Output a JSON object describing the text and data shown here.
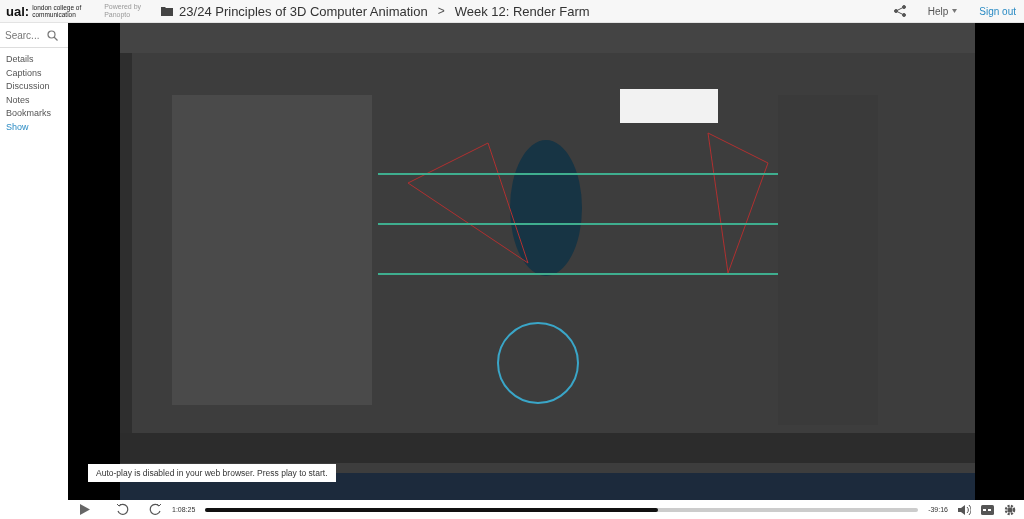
{
  "header": {
    "logo": {
      "mark": "ual:",
      "subtitle": "london college of communication"
    },
    "powered_by": "Powered by\nPanopto",
    "breadcrumb": [
      {
        "label": "23/24 Principles of 3D Computer Animation"
      },
      {
        "label": "Week 12: Render Farm"
      }
    ],
    "separator": ">",
    "help": "Help",
    "sign_out": "Sign out"
  },
  "sidebar": {
    "search": {
      "placeholder": "Searc..."
    },
    "items": [
      {
        "label": "Details",
        "selected": false
      },
      {
        "label": "Captions",
        "selected": false
      },
      {
        "label": "Discussion",
        "selected": false
      },
      {
        "label": "Notes",
        "selected": false
      },
      {
        "label": "Bookmarks",
        "selected": false
      },
      {
        "label": "Show",
        "selected": true
      }
    ]
  },
  "video": {
    "kind": "picture",
    "tooltip": "Auto-play is disabled in your web browser. Press play to start."
  },
  "controls": {
    "elapsed": "1:08:25",
    "remaining": "-39:16",
    "level": 0.635
  }
}
